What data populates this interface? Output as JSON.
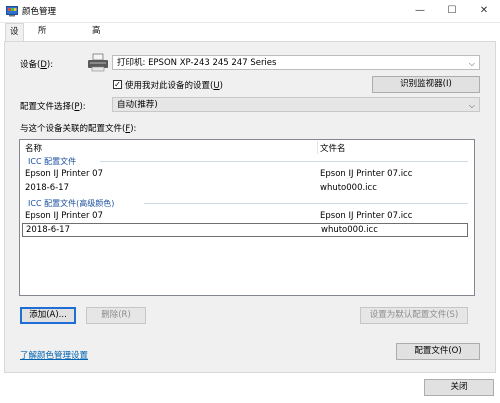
{
  "window": {
    "title": "颜色管理",
    "controls": {
      "minimize": "—",
      "maximize": "☐",
      "close": "✕"
    }
  },
  "tabs": [
    {
      "label": "设备",
      "active": true
    },
    {
      "label": "所有配置文件",
      "active": false
    },
    {
      "label": "高级",
      "active": false
    }
  ],
  "device": {
    "label": "设备(",
    "label_key": "D",
    "label_end": "):",
    "selected": "打印机: EPSON XP-243 245 247 Series",
    "use_settings_checkbox": {
      "checked": true,
      "label": "使用我对此设备的设置(",
      "label_key": "U",
      "label_end": ")"
    },
    "identify_button": "识别监视器(I)"
  },
  "profile_selection": {
    "label": "配置文件选择(",
    "label_key": "P",
    "label_end": "):",
    "value": "自动(推荐)"
  },
  "associated": {
    "label": "与这个设备关联的配置文件(",
    "label_key": "F",
    "label_end": "):",
    "columns": {
      "name": "名称",
      "file": "文件名"
    },
    "groups": [
      {
        "title": "ICC 配置文件",
        "rows": [
          {
            "name": "Epson IJ Printer 07",
            "file": "Epson IJ Printer 07.icc",
            "selected": false
          },
          {
            "name": "2018-6-17",
            "file": "whuto000.icc",
            "selected": false
          }
        ]
      },
      {
        "title": "ICC 配置文件(高级颜色)",
        "rows": [
          {
            "name": "Epson IJ Printer 07",
            "file": "Epson IJ Printer 07.icc",
            "selected": false
          },
          {
            "name": "2018-6-17",
            "file": "whuto000.icc",
            "selected": true
          }
        ]
      }
    ]
  },
  "buttons": {
    "add": "添加(A)...",
    "remove": "删除(R)",
    "set_default": "设置为默认配置文件(S)",
    "profiles": "配置文件(O)",
    "close": "关闭"
  },
  "footer_link": "了解颜色管理设置"
}
